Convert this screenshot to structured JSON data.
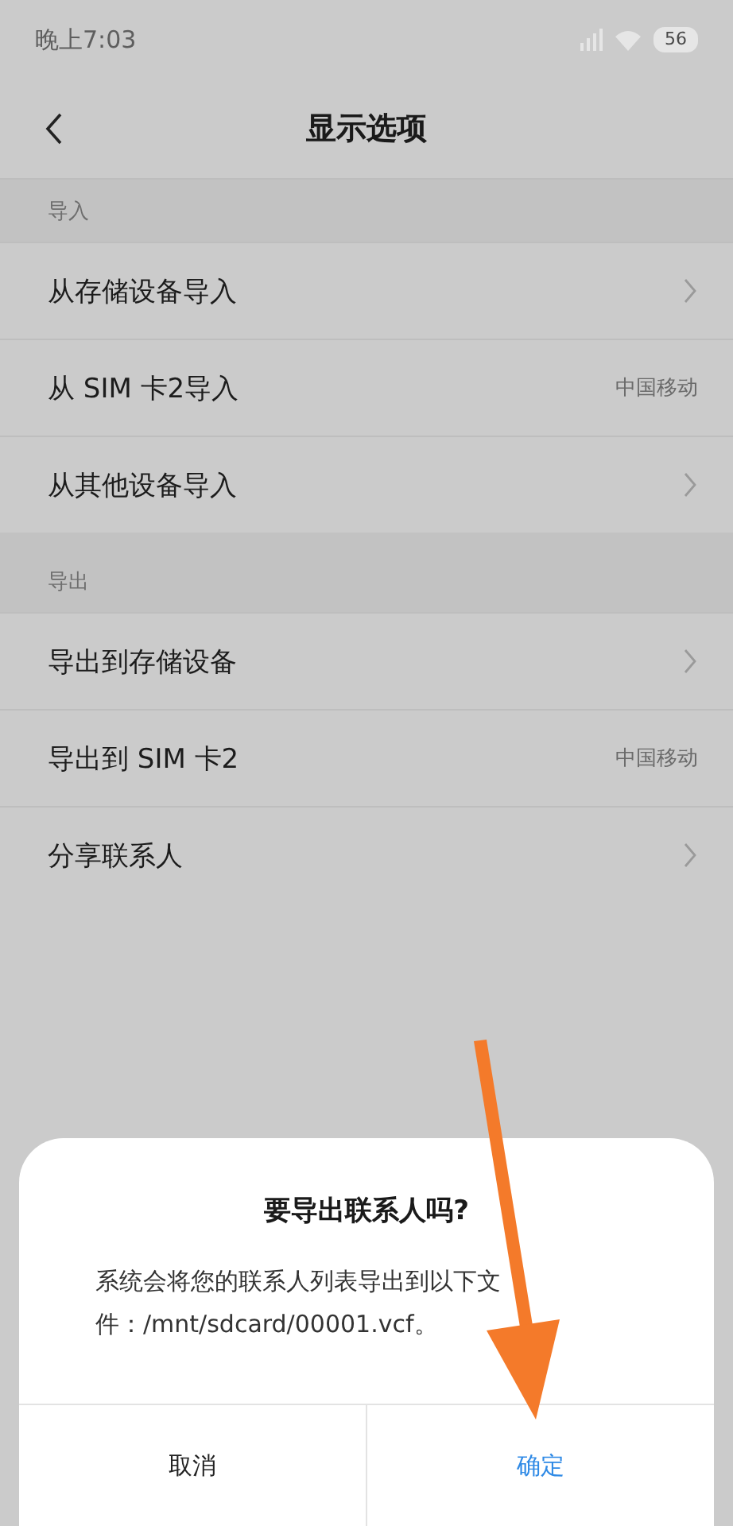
{
  "status_bar": {
    "time": "晚上7:03",
    "battery": "56"
  },
  "header": {
    "title": "显示选项"
  },
  "sections": [
    {
      "title": "导入",
      "rows": [
        {
          "label": "从存储设备导入",
          "kind": "link"
        },
        {
          "label": "从 SIM 卡2导入",
          "kind": "value",
          "value": "中国移动"
        },
        {
          "label": "从其他设备导入",
          "kind": "link"
        }
      ]
    },
    {
      "title": "导出",
      "rows": [
        {
          "label": "导出到存储设备",
          "kind": "link"
        },
        {
          "label": "导出到 SIM 卡2",
          "kind": "value",
          "value": "中国移动"
        },
        {
          "label": "分享联系人",
          "kind": "link"
        }
      ]
    }
  ],
  "dialog": {
    "title": "要导出联系人吗?",
    "message": "系统会将您的联系人列表导出到以下文件：/mnt/sdcard/00001.vcf。",
    "buttons": [
      {
        "label": "取消",
        "kind": "cancel"
      },
      {
        "label": "确定",
        "kind": "confirm"
      }
    ]
  }
}
